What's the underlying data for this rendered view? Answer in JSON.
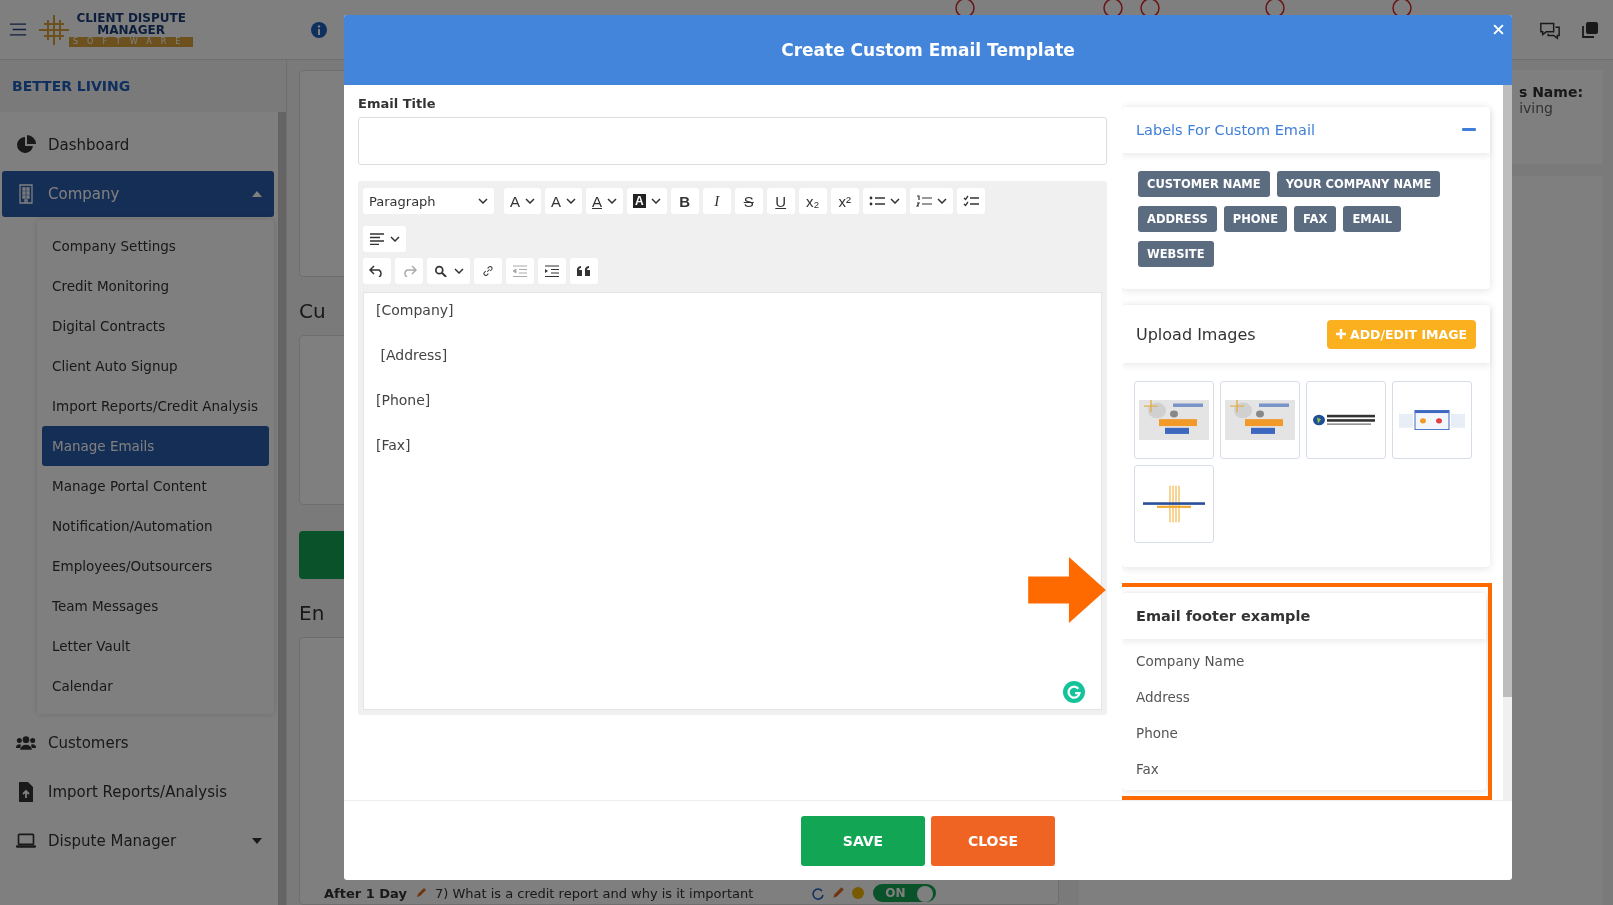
{
  "header": {
    "logo": {
      "line1": "CLIENT DISPUTE",
      "line2": "MANAGER",
      "line3": "SOFTWARE"
    }
  },
  "sidebar": {
    "account": "BETTER LIVING",
    "items": [
      {
        "label": "Dashboard",
        "kind": "link",
        "selected": false
      },
      {
        "label": "Company",
        "kind": "group",
        "selected": true,
        "expanded": true,
        "children": [
          {
            "label": "Company Settings",
            "selected": false
          },
          {
            "label": "Credit Monitoring",
            "selected": false
          },
          {
            "label": "Digital Contracts",
            "selected": false
          },
          {
            "label": "Client Auto Signup",
            "selected": false
          },
          {
            "label": "Import Reports/Credit Analysis",
            "selected": false
          },
          {
            "label": "Manage Emails",
            "selected": true
          },
          {
            "label": "Manage Portal Content",
            "selected": false
          },
          {
            "label": "Notification/Automation",
            "selected": false
          },
          {
            "label": "Employees/Outsourcers",
            "selected": false
          },
          {
            "label": "Team Messages",
            "selected": false
          },
          {
            "label": "Letter Vault",
            "selected": false
          },
          {
            "label": "Calendar",
            "selected": false
          }
        ]
      },
      {
        "label": "Customers",
        "kind": "link",
        "selected": false
      },
      {
        "label": "Import Reports/Analysis",
        "kind": "link",
        "selected": false
      },
      {
        "label": "Dispute Manager",
        "kind": "group",
        "selected": false,
        "expanded": false
      }
    ]
  },
  "background": {
    "headings": [
      "Cu",
      "En"
    ],
    "right_label": "s Name:",
    "right_value": "iving",
    "row": {
      "title": "After 1 Day",
      "text": "7) What is a credit report and why is it important",
      "toggle": {
        "label": "ON",
        "on": true
      }
    }
  },
  "modal": {
    "title": "Create Custom Email Template",
    "email_title": {
      "label": "Email Title"
    },
    "editor": {
      "format": "Paragraph",
      "toolbar": [
        [
          {
            "kind": "font-size",
            "glyph": "A",
            "dropdown": true,
            "disabled": false
          },
          {
            "kind": "line-height",
            "glyph": "A",
            "dropdown": true,
            "disabled": false
          },
          {
            "kind": "font-color",
            "glyph": "A",
            "dropdown": true,
            "disabled": false
          },
          {
            "kind": "highlight",
            "glyph": "A",
            "dropdown": true,
            "disabled": false
          },
          {
            "kind": "bold",
            "glyph": "B",
            "dropdown": false,
            "disabled": false
          },
          {
            "kind": "italic",
            "glyph": "I",
            "dropdown": false,
            "disabled": false
          },
          {
            "kind": "strike",
            "glyph": "S",
            "dropdown": false,
            "disabled": false
          },
          {
            "kind": "underline",
            "glyph": "U",
            "dropdown": false,
            "disabled": false
          },
          {
            "kind": "subscript",
            "glyph": "x₂",
            "dropdown": false,
            "disabled": false
          },
          {
            "kind": "superscript",
            "glyph": "x²",
            "dropdown": false,
            "disabled": false
          },
          {
            "kind": "bullet-list",
            "dropdown": true,
            "disabled": false
          },
          {
            "kind": "numbered-list",
            "dropdown": true,
            "disabled": false
          },
          {
            "kind": "todo-list",
            "dropdown": false,
            "disabled": false
          },
          {
            "kind": "align",
            "dropdown": true,
            "disabled": false
          }
        ],
        [
          {
            "kind": "undo",
            "dropdown": false,
            "disabled": false
          },
          {
            "kind": "redo",
            "dropdown": false,
            "disabled": true
          },
          {
            "kind": "find",
            "dropdown": true,
            "disabled": false
          },
          {
            "kind": "link",
            "dropdown": false,
            "disabled": false
          },
          {
            "kind": "outdent",
            "dropdown": false,
            "disabled": true
          },
          {
            "kind": "indent",
            "dropdown": false,
            "disabled": false
          },
          {
            "kind": "quote",
            "dropdown": false,
            "disabled": false
          }
        ]
      ],
      "lines": [
        "[Company]",
        " [Address]",
        "[Phone]",
        "[Fax]"
      ]
    },
    "labels_card": {
      "title": "Labels For Custom Email",
      "expanded": true,
      "chips": [
        "CUSTOMER NAME",
        "YOUR COMPANY NAME",
        "ADDRESS",
        "PHONE",
        "FAX",
        "EMAIL",
        "WEBSITE"
      ]
    },
    "upload_card": {
      "title": "Upload Images",
      "button": "ADD/EDIT IMAGE"
    },
    "footer_example": {
      "title": "Email footer example",
      "highlighted": true,
      "lines": [
        "Company Name",
        "Address",
        "Phone",
        "Fax"
      ]
    },
    "buttons": [
      {
        "label": "SAVE",
        "kind": "primary"
      },
      {
        "label": "CLOSE",
        "kind": "danger"
      }
    ]
  }
}
